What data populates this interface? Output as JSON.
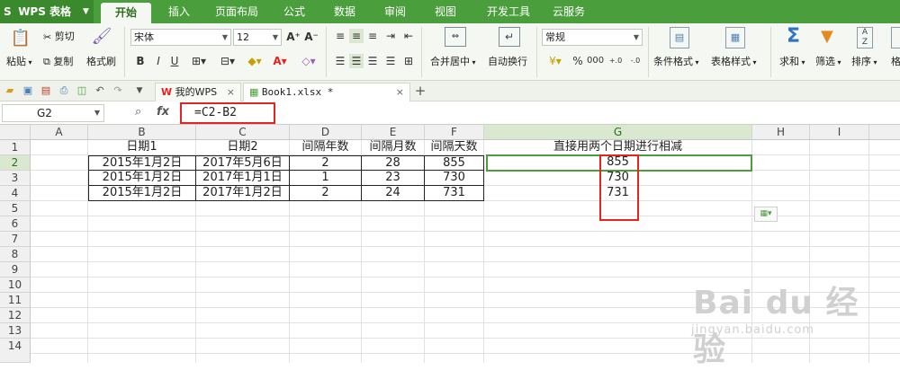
{
  "app": {
    "logo": "WPS 表格"
  },
  "menu": [
    "开始",
    "插入",
    "页面布局",
    "公式",
    "数据",
    "审阅",
    "视图",
    "开发工具",
    "云服务"
  ],
  "ribbon": {
    "paste": "粘贴",
    "cut": "剪切",
    "copy": "复制",
    "format_painter": "格式刷",
    "font_name": "宋体",
    "font_size": "12",
    "number_format": "常规",
    "merge_center": "合并居中",
    "wrap_text": "自动换行",
    "conditional_format": "条件格式",
    "table_style": "表格样式",
    "sum": "求和",
    "filter": "筛选",
    "sort": "排序",
    "format": "格",
    "bold": "B",
    "italic": "I",
    "underline": "U"
  },
  "doc_tabs": [
    {
      "label": "我的WPS"
    },
    {
      "label": "Book1.xlsx *"
    }
  ],
  "formula_bar": {
    "name_box": "G2",
    "fx": "fx",
    "formula": "=C2-B2"
  },
  "sheet": {
    "columns": [
      "A",
      "B",
      "C",
      "D",
      "E",
      "F",
      "G",
      "H",
      "I"
    ],
    "rows": [
      "1",
      "2",
      "3",
      "4",
      "5",
      "6",
      "7",
      "8",
      "9",
      "10",
      "11",
      "12",
      "13",
      "14"
    ],
    "header": [
      "",
      "日期1",
      "日期2",
      "间隔年数",
      "间隔月数",
      "间隔天数",
      "直接用两个日期进行相减"
    ],
    "data": [
      [
        "",
        "2015年1月2日",
        "2017年5月6日",
        "2",
        "28",
        "855",
        "855"
      ],
      [
        "",
        "2015年1月2日",
        "2017年1月1日",
        "1",
        "23",
        "730",
        "730"
      ],
      [
        "",
        "2015年1月2日",
        "2017年1月2日",
        "2",
        "24",
        "731",
        "731"
      ]
    ]
  },
  "watermark": {
    "text": "Bai du 经验",
    "url": "jingyan.baidu.com"
  },
  "colors": {
    "accent": "#4b9e3c",
    "highlight": "#e5231f"
  }
}
